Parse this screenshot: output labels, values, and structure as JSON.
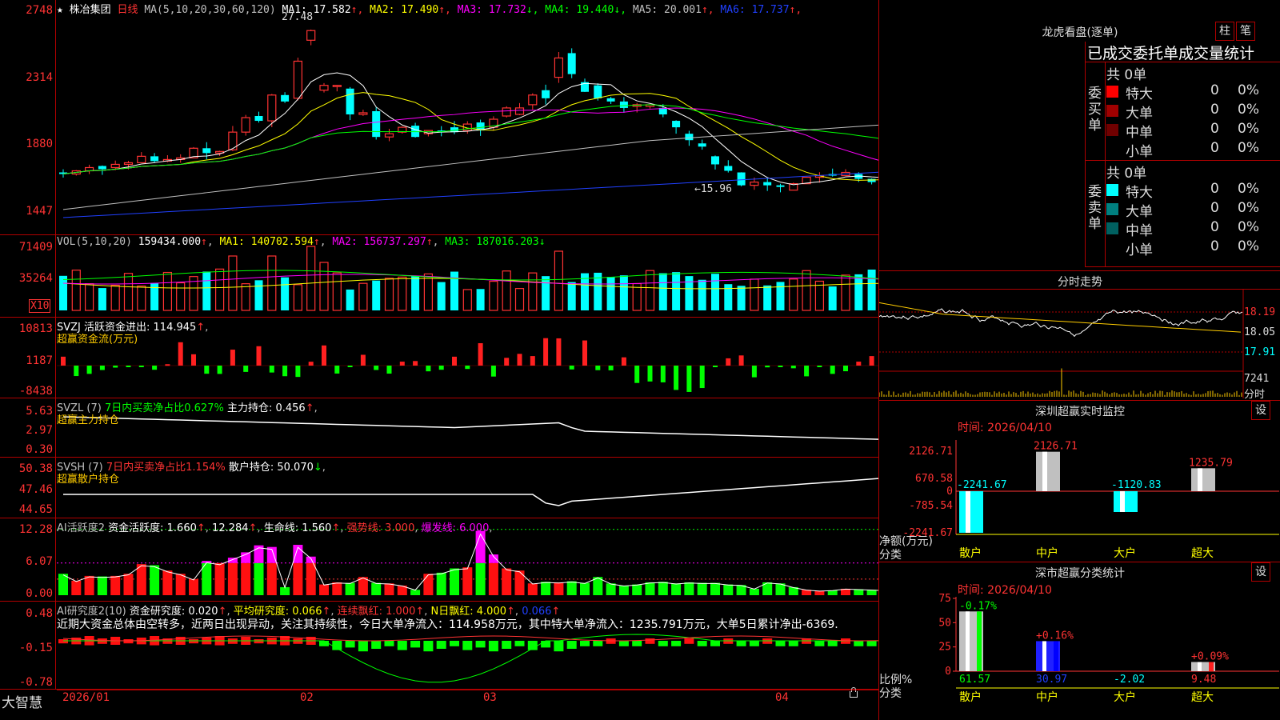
{
  "main": {
    "star": "★",
    "stock_name": "株冶集团",
    "period": "日线",
    "ma_header": "MA(5,10,20,30,60,120)",
    "ma_values": [
      {
        "label": "MA1:",
        "value": "17.582",
        "arrow": "↑",
        "color": "#ffffff"
      },
      {
        "label": "MA2:",
        "value": "17.490",
        "arrow": "↑",
        "color": "#ffff00"
      },
      {
        "label": "MA3:",
        "value": "17.732",
        "arrow": "↓",
        "color": "#ff00ff"
      },
      {
        "label": "MA4:",
        "value": "19.440",
        "arrow": "↓",
        "color": "#00ff00"
      },
      {
        "label": "MA5:",
        "value": "20.001",
        "arrow": "↑",
        "color": "#c0c0c0"
      },
      {
        "label": "MA6:",
        "value": "17.737",
        "arrow": "↑",
        "color": "#2040ff"
      }
    ],
    "y_labels": [
      "2748",
      "2314",
      "1880",
      "1447"
    ],
    "high_label": "27.48",
    "low_label": "←15.96"
  },
  "vol": {
    "header_name": "VOL(5,10,20)",
    "value": "159434.000",
    "ma1": "MA1: 140702.594",
    "ma2": "MA2: 156737.297",
    "ma3": "MA3: 187016.203",
    "y_labels": [
      "71409",
      "35264"
    ],
    "unit": "X10"
  },
  "svzj": {
    "header": "SVZJ  活跃资金进出: 114.945",
    "sub": "超赢资金流(万元)",
    "y_labels": [
      "10813",
      "1187",
      "-8438"
    ]
  },
  "svzl": {
    "header_a": "SVZL (7)",
    "header_b": "7日内买卖净占比0.627%",
    "header_c": "主力持仓: 0.456",
    "sub": "超赢主力持仓",
    "y_labels": [
      "5.63",
      "2.97",
      "0.30"
    ]
  },
  "svsh": {
    "header_a": "SVSH (7)",
    "header_b": "7日内买卖净占比1.154%",
    "header_c": "散户持仓: 50.070",
    "sub": "超赢散户持仓",
    "y_labels": [
      "50.38",
      "47.46",
      "44.65"
    ]
  },
  "ai1": {
    "header_a": "AI活跃度2",
    "header_b": "资金活跃度: 1.660",
    "header_c": "12.284",
    "header_d": "生命线: 1.560",
    "header_e": "强势线: 3.000",
    "header_f": "爆发线: 6.000",
    "y_labels": [
      "12.28",
      "6.07",
      "0.00"
    ]
  },
  "ai2": {
    "header_a": "AI研究度2(10)",
    "header_b": "资金研究度: 0.020",
    "header_c": "平均研究度: 0.066",
    "header_d": "连续飘红: 1.000",
    "header_e": "N日飘红: 4.000",
    "header_f": "0.066",
    "commentary": "近期大资金总体由空转多，近两日出现异动，关注其持续性，今日大单净流入：114.958万元，其中特大单净流入：1235.791万元，大单5日累计净出-6369.",
    "y_labels": [
      "0.48",
      "-0.15",
      "-0.78"
    ]
  },
  "xaxis": {
    "brand": "大智慧",
    "dates": [
      "2026/01",
      "02",
      "03",
      "04"
    ]
  },
  "dragon": {
    "title": "龙虎看盘(逐单)",
    "btn_zhu": "柱",
    "btn_bi": "笔",
    "subtitle": "已成交委托单成交量统计",
    "buy_label": "委买单",
    "sell_label": "委卖单",
    "buy_total": "共 0单",
    "sell_total": "共 0单",
    "buy_rows": [
      {
        "name": "特大",
        "count": "0",
        "pct": "0%",
        "color": "#ff0000"
      },
      {
        "name": "大单",
        "count": "0",
        "pct": "0%",
        "color": "#a00000"
      },
      {
        "name": "中单",
        "count": "0",
        "pct": "0%",
        "color": "#700000"
      },
      {
        "name": "小单",
        "count": "0",
        "pct": "0%",
        "color": ""
      }
    ],
    "sell_rows": [
      {
        "name": "特大",
        "count": "0",
        "pct": "0%",
        "color": "#00ffff"
      },
      {
        "name": "大单",
        "count": "0",
        "pct": "0%",
        "color": "#008080"
      },
      {
        "name": "中单",
        "count": "0",
        "pct": "0%",
        "color": "#006060"
      },
      {
        "name": "小单",
        "count": "0",
        "pct": "0%",
        "color": ""
      }
    ]
  },
  "intraday": {
    "title": "分时走势",
    "prices": [
      "18.19",
      "18.05",
      "17.91"
    ],
    "vol": "7241",
    "vol_unit": "分时"
  },
  "monitor": {
    "title": "深圳超赢实时监控",
    "set": "设",
    "time": "时间: 2026/04/10",
    "y_labels": [
      "2126.71",
      "670.58",
      "0",
      "-785.54",
      "-2241.67"
    ],
    "ylabel_a": "净额(万元)",
    "ylabel_b": "分类",
    "categories": [
      "散户",
      "中户",
      "大户",
      "超大"
    ],
    "values": [
      -2241.67,
      2126.71,
      -1120.83,
      1235.79
    ],
    "value_labels": [
      "-2241.67",
      "2126.71",
      "-1120.83",
      "1235.79"
    ]
  },
  "classify": {
    "title": "深市超赢分类统计",
    "set": "设",
    "time": "时间: 2026/04/10",
    "y_labels": [
      "75",
      "50",
      "25",
      "0"
    ],
    "ylabel_a": "比例%",
    "ylabel_b": "分类",
    "categories": [
      "散户",
      "中户",
      "大户",
      "超大"
    ],
    "percents": [
      61.57,
      30.97,
      -2.02,
      9.48
    ],
    "pct_labels": [
      "61.57",
      "30.97",
      "-2.02",
      "9.48"
    ],
    "changes": [
      "-0.17%",
      "+0.16%",
      "",
      "+0.09%"
    ]
  },
  "chart_data": {
    "type": "candlestick",
    "candles": [
      {
        "o": 17.4,
        "c": 17.3
      },
      {
        "o": 17.3,
        "c": 17.5
      },
      {
        "o": 17.5,
        "c": 17.7
      },
      {
        "o": 17.8,
        "c": 17.6
      },
      {
        "o": 17.7,
        "c": 17.9
      },
      {
        "o": 17.9,
        "c": 18.0
      },
      {
        "o": 18.0,
        "c": 18.4
      },
      {
        "o": 18.4,
        "c": 18.1
      },
      {
        "o": 18.1,
        "c": 18.2
      },
      {
        "o": 18.2,
        "c": 18.3
      },
      {
        "o": 18.3,
        "c": 18.9
      },
      {
        "o": 18.9,
        "c": 18.6
      },
      {
        "o": 18.6,
        "c": 18.7
      },
      {
        "o": 18.8,
        "c": 19.9
      },
      {
        "o": 19.9,
        "c": 20.8
      },
      {
        "o": 20.9,
        "c": 20.6
      },
      {
        "o": 20.6,
        "c": 22.2
      },
      {
        "o": 22.2,
        "c": 21.8
      },
      {
        "o": 22.0,
        "c": 24.3
      },
      {
        "o": 25.6,
        "c": 26.2
      },
      {
        "o": 22.5,
        "c": 22.8
      },
      {
        "o": 22.8,
        "c": 22.8
      },
      {
        "o": 22.6,
        "c": 21.0
      },
      {
        "o": 21.0,
        "c": 21.1
      },
      {
        "o": 21.2,
        "c": 19.6
      },
      {
        "o": 19.6,
        "c": 19.8
      },
      {
        "o": 19.9,
        "c": 20.2
      },
      {
        "o": 20.3,
        "c": 19.6
      },
      {
        "o": 19.8,
        "c": 20.0
      },
      {
        "o": 20.0,
        "c": 19.9
      },
      {
        "o": 20.2,
        "c": 19.9
      },
      {
        "o": 20.0,
        "c": 20.4
      },
      {
        "o": 20.5,
        "c": 20.0
      },
      {
        "o": 20.2,
        "c": 20.7
      },
      {
        "o": 20.9,
        "c": 21.4
      },
      {
        "o": 21.0,
        "c": 21.4
      },
      {
        "o": 21.6,
        "c": 22.2
      },
      {
        "o": 22.5,
        "c": 22.0
      },
      {
        "o": 23.3,
        "c": 24.5
      },
      {
        "o": 24.8,
        "c": 23.5
      },
      {
        "o": 23.0,
        "c": 22.4
      },
      {
        "o": 22.8,
        "c": 22.0
      },
      {
        "o": 22.0,
        "c": 21.8
      },
      {
        "o": 21.8,
        "c": 21.4
      },
      {
        "o": 21.5,
        "c": 21.6
      },
      {
        "o": 21.5,
        "c": 21.6
      },
      {
        "o": 21.4,
        "c": 21.0
      },
      {
        "o": 20.6,
        "c": 20.2
      },
      {
        "o": 19.8,
        "c": 19.4
      },
      {
        "o": 19.2,
        "c": 19.0
      },
      {
        "o": 18.4,
        "c": 17.9
      },
      {
        "o": 17.8,
        "c": 17.5
      },
      {
        "o": 17.4,
        "c": 16.6
      },
      {
        "o": 16.6,
        "c": 16.8
      },
      {
        "o": 16.8,
        "c": 16.6
      },
      {
        "o": 16.6,
        "c": 16.5
      },
      {
        "o": 16.3,
        "c": 16.7
      },
      {
        "o": 16.7,
        "c": 17.1
      },
      {
        "o": 17.1,
        "c": 17.2
      },
      {
        "o": 17.3,
        "c": 17.2
      },
      {
        "o": 17.2,
        "c": 17.4
      },
      {
        "o": 17.3,
        "c": 17.0
      },
      {
        "o": 17.0,
        "c": 16.8
      },
      {
        "o": 16.9,
        "c": 17.0
      },
      {
        "o": 17.2,
        "c": 17.1
      },
      {
        "o": 17.1,
        "c": 17.4
      },
      {
        "o": 17.4,
        "c": 17.3
      },
      {
        "o": 17.3,
        "c": 17.5
      },
      {
        "o": 17.5,
        "c": 17.8
      },
      {
        "o": 17.8,
        "c": 17.6
      }
    ]
  }
}
